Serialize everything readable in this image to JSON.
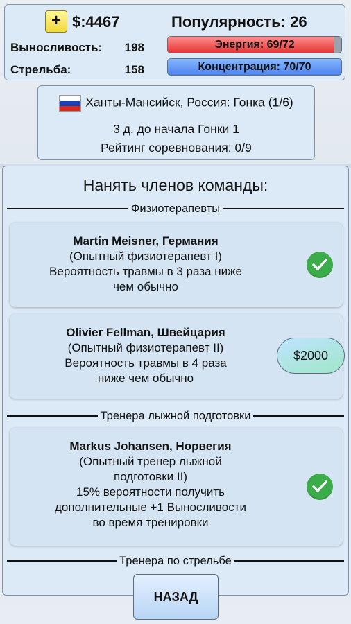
{
  "header": {
    "plus_label": "+",
    "money": "$:4467",
    "popularity": "Популярность: 26",
    "stamina_label": "Выносливость:",
    "stamina_value": "198",
    "shooting_label": "Стрельба:",
    "shooting_value": "158",
    "energy_text": "Энергия: 69/72",
    "energy_level": 0.958,
    "concentration_text": "Концентрация: 70/70",
    "concentration_level": 1.0
  },
  "event": {
    "location": "Ханты-Мансийск, Россия: Гонка (1/6)",
    "countdown": "3 д. до начала Гонки 1",
    "rating": "Рейтинг соревнования: 0/9",
    "flag_colors": [
      "#ffffff",
      "#1c3fb8",
      "#d52b1e"
    ]
  },
  "dialog": {
    "title": "Нанять членов команды:",
    "sections": [
      {
        "title": "Физиотерапевты",
        "members": [
          {
            "name": "Martin Meisner, Германия",
            "role": "(Опытный физиотерапевт I)",
            "desc1": "Вероятность травмы в 3 раза ниже",
            "desc2": "чем обычно",
            "status": "hired",
            "status_icon": "check-icon"
          },
          {
            "name": "Olivier Fellman, Швейцария",
            "role": "(Опытный физиотерапевт II)",
            "desc1": "Вероятность травмы в 4 раза",
            "desc2": "ниже чем обычно",
            "status": "for-hire",
            "price": "$2000"
          }
        ]
      },
      {
        "title": "Тренера лыжной подготовки",
        "members": [
          {
            "name": "Markus Johansen, Норвегия",
            "role1": "(Опытный тренер лыжной",
            "role2": "подготовки II)",
            "desc1": "15% вероятности получить",
            "desc2": "дополнительные +1 Выносливости",
            "desc3": "во время тренировки",
            "status": "hired",
            "status_icon": "check-icon"
          }
        ]
      },
      {
        "title": "Тренера по стрельбе"
      }
    ]
  },
  "footer": {
    "back_label": "НАЗАД"
  },
  "colors": {
    "panel_bg": "#dce9f6",
    "energy_bar": "#e53333",
    "concentration_bar": "#4d84f0",
    "check_green": "#3cab49",
    "plus_yellow": "#f1d93a"
  }
}
